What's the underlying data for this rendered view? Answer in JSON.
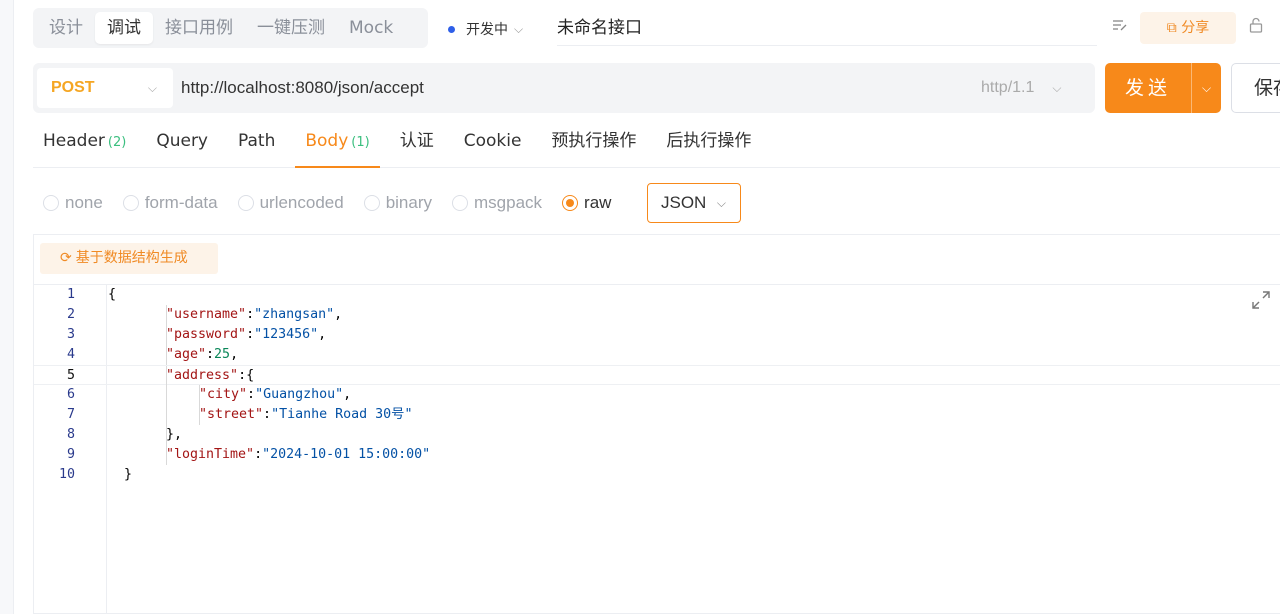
{
  "mode_tabs": [
    "设计",
    "调试",
    "接口用例",
    "一键压测",
    "Mock"
  ],
  "mode_active_index": 1,
  "env": {
    "label": "开发中",
    "dot_color": "#2e5fe8"
  },
  "api_name": "未命名接口",
  "header_actions": {
    "share_label": "分享"
  },
  "request": {
    "method": "POST",
    "method_color": "#f5a623",
    "url": "http://localhost:8080/json/accept",
    "http_version": "http/1.1",
    "send_label": "发送",
    "save_label": "保存"
  },
  "request_tabs": [
    {
      "label": "Header",
      "count": "(2)"
    },
    {
      "label": "Query",
      "count": ""
    },
    {
      "label": "Path",
      "count": ""
    },
    {
      "label": "Body",
      "count": "(1)"
    },
    {
      "label": "认证",
      "count": ""
    },
    {
      "label": "Cookie",
      "count": ""
    },
    {
      "label": "预执行操作",
      "count": ""
    },
    {
      "label": "后执行操作",
      "count": ""
    }
  ],
  "request_active_index": 3,
  "body_types": [
    "none",
    "form-data",
    "urlencoded",
    "binary",
    "msgpack",
    "raw"
  ],
  "body_type_selected": "raw",
  "body_format": "JSON",
  "generate_button": "基于数据结构生成",
  "accent_color": "#f7891a",
  "code_lines": [
    {
      "n": "1",
      "indent": 0,
      "parts": [
        [
          "p",
          "{"
        ]
      ]
    },
    {
      "n": "2",
      "indent": 1,
      "parts": [
        [
          "k",
          "\"username\""
        ],
        [
          "p",
          ":"
        ],
        [
          "s",
          "\"zhangsan\""
        ],
        [
          "p",
          ","
        ]
      ]
    },
    {
      "n": "3",
      "indent": 1,
      "parts": [
        [
          "k",
          "\"password\""
        ],
        [
          "p",
          ":"
        ],
        [
          "s",
          "\"123456\""
        ],
        [
          "p",
          ","
        ]
      ]
    },
    {
      "n": "4",
      "indent": 1,
      "parts": [
        [
          "k",
          "\"age\""
        ],
        [
          "p",
          ":"
        ],
        [
          "n",
          "25"
        ],
        [
          "p",
          ","
        ]
      ]
    },
    {
      "n": "5",
      "indent": 1,
      "parts": [
        [
          "k",
          "\"address\""
        ],
        [
          "p",
          ":{"
        ]
      ]
    },
    {
      "n": "6",
      "indent": 2,
      "parts": [
        [
          "k",
          "\"city\""
        ],
        [
          "p",
          ":"
        ],
        [
          "s",
          "\"Guangzhou\""
        ],
        [
          "p",
          ","
        ]
      ]
    },
    {
      "n": "7",
      "indent": 2,
      "parts": [
        [
          "k",
          "\"street\""
        ],
        [
          "p",
          ":"
        ],
        [
          "s",
          "\"Tianhe Road 30号\""
        ]
      ]
    },
    {
      "n": "8",
      "indent": 1,
      "parts": [
        [
          "p",
          "},"
        ]
      ]
    },
    {
      "n": "9",
      "indent": 1,
      "parts": [
        [
          "k",
          "\"loginTime\""
        ],
        [
          "p",
          ":"
        ],
        [
          "s",
          "\"2024-10-01 15:00:00\""
        ]
      ]
    },
    {
      "n": "10",
      "indent": 0,
      "parts": [
        [
          "p",
          "  }"
        ]
      ]
    }
  ],
  "current_line": "5"
}
